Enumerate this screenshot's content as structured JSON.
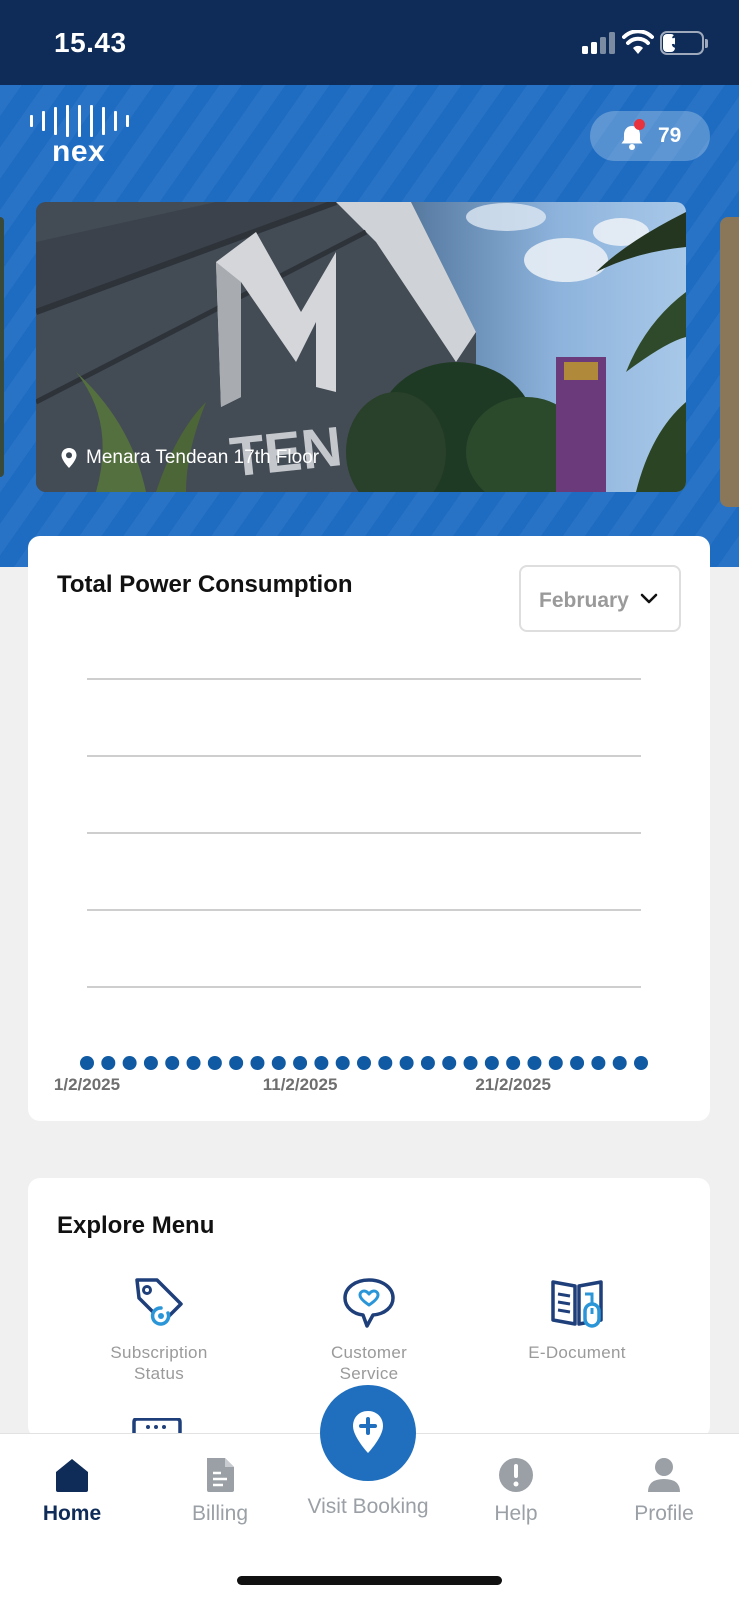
{
  "status_bar": {
    "time": "15.43",
    "battery": "31",
    "battery_level_percent": 31
  },
  "header": {
    "logo_text": "nex",
    "notification_count": "79",
    "accent_color": "#1d6cc2"
  },
  "banner": {
    "location_label": "Menara Tendean 17th Floor",
    "image_description_icon": "building-photo"
  },
  "power_chart": {
    "title": "Total Power Consumption",
    "month_selector": "February",
    "x_tick_labels": [
      "1/2/2025",
      "11/2/2025",
      "21/2/2025"
    ]
  },
  "chart_data": {
    "type": "line",
    "title": "Total Power Consumption",
    "x": [
      "1/2/2025",
      "2/2/2025",
      "3/2/2025",
      "4/2/2025",
      "5/2/2025",
      "6/2/2025",
      "7/2/2025",
      "8/2/2025",
      "9/2/2025",
      "10/2/2025",
      "11/2/2025",
      "12/2/2025",
      "13/2/2025",
      "14/2/2025",
      "15/2/2025",
      "16/2/2025",
      "17/2/2025",
      "18/2/2025",
      "19/2/2025",
      "20/2/2025",
      "21/2/2025",
      "22/2/2025",
      "23/2/2025",
      "24/2/2025",
      "25/2/2025",
      "26/2/2025",
      "27/2/2025"
    ],
    "series": [
      {
        "values": [
          0,
          0,
          0,
          0,
          0,
          0,
          0,
          0,
          0,
          0,
          0,
          0,
          0,
          0,
          0,
          0,
          0,
          0,
          0,
          0,
          0,
          0,
          0,
          0,
          0,
          0,
          0
        ]
      }
    ],
    "xlabel": "",
    "ylabel": "",
    "gridlines": 5,
    "grid": true,
    "point_color": "#0f5aa3"
  },
  "explore_menu": {
    "title": "Explore Menu",
    "items": [
      {
        "label_line1": "Subscription",
        "label_line2": "Status",
        "icon": "price-tag-icon"
      },
      {
        "label_line1": "Customer",
        "label_line2": "Service",
        "icon": "chat-heart-icon"
      },
      {
        "label_line1": "E-Document",
        "label_line2": "",
        "icon": "book-document-icon"
      }
    ]
  },
  "bottom_nav": {
    "items": [
      {
        "label": "Home",
        "icon": "home-icon",
        "active": true
      },
      {
        "label": "Billing",
        "icon": "billing-icon",
        "active": false
      },
      {
        "label": "Visit Booking",
        "icon": "location-plus-icon",
        "active": false
      },
      {
        "label": "Help",
        "icon": "help-icon",
        "active": false
      },
      {
        "label": "Profile",
        "icon": "profile-icon",
        "active": false
      }
    ]
  }
}
